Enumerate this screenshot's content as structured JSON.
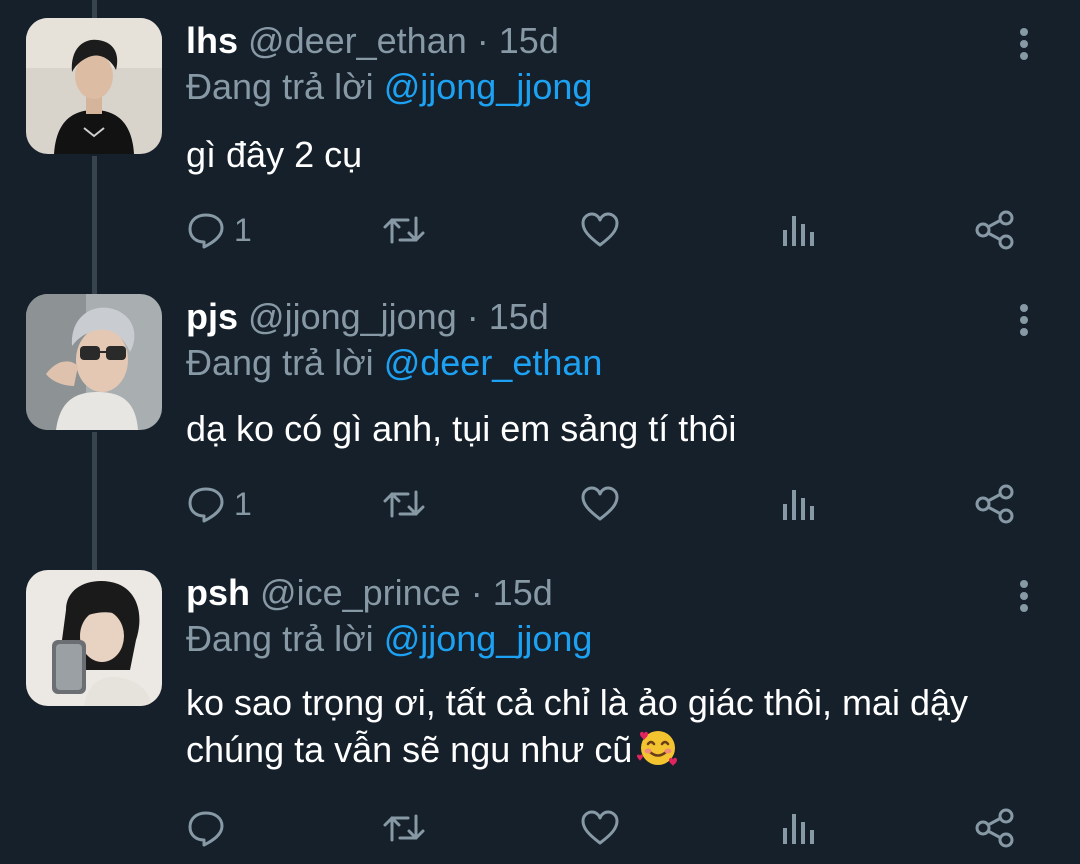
{
  "colors": {
    "background": "#15202b",
    "thread_line": "#38444d",
    "secondary_text": "#8899a6",
    "link": "#1da1f2",
    "primary_text": "#ffffff"
  },
  "replies": [
    {
      "display_name": "lhs",
      "handle": "@deer_ethan",
      "separator": "·",
      "time": "15d",
      "reply_prefix": "Đang trả lời",
      "reply_to": "@jjong_jjong",
      "text": "gì đây 2 cụ",
      "reply_count": "1",
      "icons": [
        "reply-icon",
        "retweet-icon",
        "like-icon",
        "analytics-icon",
        "share-icon",
        "more-icon"
      ]
    },
    {
      "display_name": "pjs",
      "handle": "@jjong_jjong",
      "separator": "·",
      "time": "15d",
      "reply_prefix": "Đang trả lời",
      "reply_to": "@deer_ethan",
      "text": "dạ ko có gì anh, tụi em sảng tí thôi",
      "reply_count": "1",
      "icons": [
        "reply-icon",
        "retweet-icon",
        "like-icon",
        "analytics-icon",
        "share-icon",
        "more-icon"
      ]
    },
    {
      "display_name": "psh",
      "handle": "@ice_prince",
      "separator": "·",
      "time": "15d",
      "reply_prefix": "Đang trả lời",
      "reply_to": "@jjong_jjong",
      "text": "ko sao trọng ơi, tất cả chỉ là ảo giác thôi, mai dậy chúng ta vẫn sẽ ngu như cũ",
      "emoji": "smiling-face-with-hearts",
      "reply_count": "",
      "icons": [
        "reply-icon",
        "retweet-icon",
        "like-icon",
        "analytics-icon",
        "share-icon",
        "more-icon"
      ]
    }
  ]
}
